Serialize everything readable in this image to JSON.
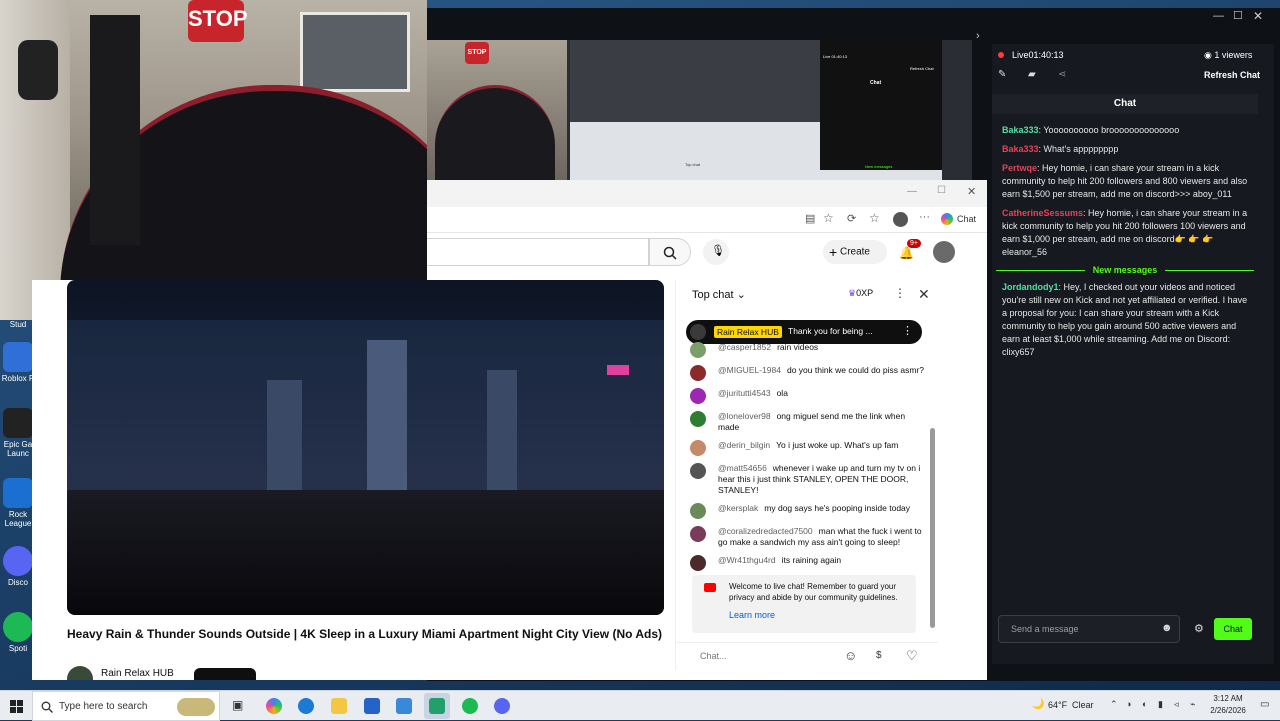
{
  "desktop": {
    "icons": [
      {
        "label": "Stud",
        "color": "#3a3a3a"
      },
      {
        "label": "Roblox P",
        "color": "#2f6fd6"
      },
      {
        "label": "Epic Ga Launc",
        "color": "#222222"
      },
      {
        "label": "Rock League",
        "color": "#1a6fd0"
      },
      {
        "label": "Disco",
        "color": "#5865f2"
      },
      {
        "label": "Spoti",
        "color": "#1db954"
      }
    ]
  },
  "webcam": {
    "sign_text": "STOP"
  },
  "obs_preview": {
    "sign_text": "STOP",
    "mini_chat_title": "Chat",
    "mini_live": "Live 01:40:13",
    "mini_refresh": "Refresh Chat",
    "mini_new_messages": "New messages",
    "mini_topchat": "Top chat"
  },
  "browser": {
    "chat_button": "Chat",
    "create_label": "Create",
    "notif_count": "9+",
    "video_title": "Heavy Rain & Thunder Sounds Outside | 4K Sleep in a Luxury Miami Apartment Night City View (No Ads)",
    "channel_name": "Rain Relax HUB"
  },
  "yt_chat": {
    "top_chat_label": "Top chat",
    "xp_label": "0XP",
    "pinned_channel": "Rain Relax HUB",
    "pinned_text": "Thank you for being ...",
    "messages": [
      {
        "author": "@casper1852",
        "text": "rain videos",
        "color": "#7b9e6b"
      },
      {
        "author": "@MIGUEL-1984",
        "text": "do you think we could do piss asmr?",
        "color": "#8a2a2a"
      },
      {
        "author": "@juritutti4543",
        "text": "ola",
        "color": "#9c27b0"
      },
      {
        "author": "@lonelover98",
        "text": "ong miguel send me the link when made",
        "color": "#2e7d32"
      },
      {
        "author": "@derin_bilgin",
        "text": "Yo i just woke up. What's up fam",
        "color": "#c48a6a"
      },
      {
        "author": "@matt54656",
        "text": "whenever i wake up and turn my tv on i hear this i just think STANLEY, OPEN THE DOOR, STANLEY!",
        "color": "#555555"
      },
      {
        "author": "@kersplak",
        "text": "my dog says he's pooping inside today",
        "color": "#6a8a5a"
      },
      {
        "author": "@coralizedredacted7500",
        "text": "man what the fuck i went to go make a sandwich my ass ain't going to sleep!",
        "color": "#7a3a5a"
      },
      {
        "author": "@Wr41thgu4rd",
        "text": "its raining again",
        "color": "#4a2a2a"
      }
    ],
    "welcome_text": "Welcome to live chat! Remember to guard your privacy and abide by our community guidelines.",
    "learn_more": "Learn more",
    "input_placeholder": "Chat..."
  },
  "stream_panel": {
    "live_label": "Live",
    "live_time": "01:40:13",
    "viewers": "1 viewers",
    "refresh_chat": "Refresh Chat",
    "chat_title": "Chat",
    "new_messages_label": "New messages",
    "messages": [
      {
        "user": "Baka333",
        "user_color": "#53e0a0",
        "text": ": Yoooooooooo broooooooooooooo"
      },
      {
        "user": "Baka333",
        "user_color": "#e0455a",
        "text": ": What's apppppppp"
      },
      {
        "user": "Pertwqe",
        "user_color": "#e0455a",
        "text": ": Hey homie, i can share your stream in a kick community to help hit 200 followers and 800 viewers and also earn $1,500 per stream, add me on discord>>> aboy_011"
      },
      {
        "user": "CatherineSessums",
        "user_color": "#e0455a",
        "text": ": Hey homie, i can share your stream in a kick community to help you hit 200 followers 100 viewers and earn $1,000 per stream, add me on discord👉 👉 👉 eleanor_56"
      }
    ],
    "new_messages": [
      {
        "user": "Jordandody1",
        "user_color": "#53e0a0",
        "text": ": Hey, I checked out your videos and noticed you're still new on Kick and not yet affiliated or verified. I have a proposal for you: I can share your stream with a Kick community to help you gain around 500 active viewers and earn at least $1,000 while streaming. Add me on Discord: clixy657"
      }
    ],
    "send_placeholder": "Send a message",
    "chat_button": "Chat",
    "accent": "#53fc18"
  },
  "taskbar": {
    "search_placeholder": "Type here to search",
    "weather_temp": "64°F",
    "weather_text": "Clear",
    "time": "3:12 AM",
    "date": "2/26/2026"
  }
}
